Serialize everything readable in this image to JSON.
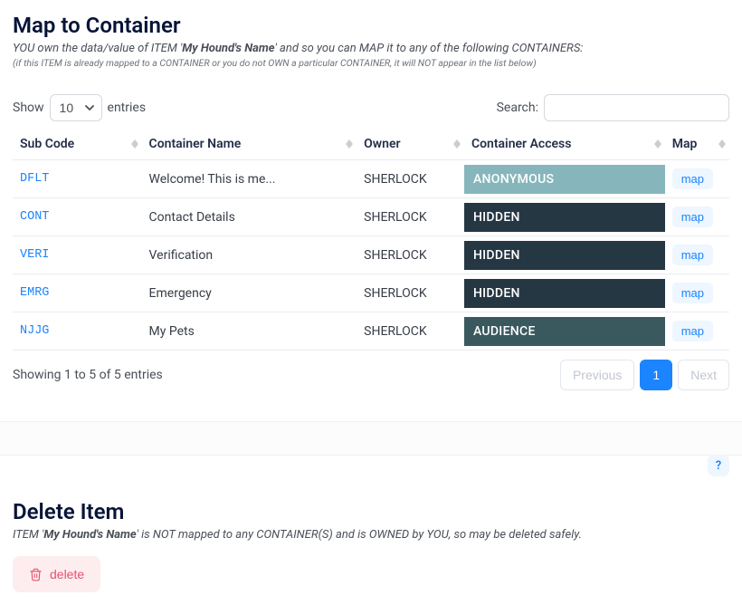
{
  "section1": {
    "title": "Map to Container",
    "subtitle_pre": "YOU own the data/value of ITEM '",
    "subtitle_item": "My Hound's Name",
    "subtitle_post": "' and so you can MAP it to any of the following CONTAINERS:",
    "note": "(if this ITEM is already mapped to a CONTAINER or you do not OWN a particular CONTAINER, it will NOT appear in the list below)"
  },
  "dt": {
    "show_label": "Show",
    "entries_label": "entries",
    "length_value": "10",
    "search_label": "Search:",
    "search_value": "",
    "columns": [
      "Sub Code",
      "Container Name",
      "Owner",
      "Container Access",
      "Map"
    ],
    "rows": [
      {
        "code": "DFLT",
        "name": "Welcome! This is me...",
        "owner": "SHERLOCK",
        "access": "ANONYMOUS",
        "access_class": "ab-anonymous",
        "map": "map"
      },
      {
        "code": "CONT",
        "name": "Contact Details",
        "owner": "SHERLOCK",
        "access": "HIDDEN",
        "access_class": "ab-hidden",
        "map": "map"
      },
      {
        "code": "VERI",
        "name": "Verification",
        "owner": "SHERLOCK",
        "access": "HIDDEN",
        "access_class": "ab-hidden",
        "map": "map"
      },
      {
        "code": "EMRG",
        "name": "Emergency",
        "owner": "SHERLOCK",
        "access": "HIDDEN",
        "access_class": "ab-hidden",
        "map": "map"
      },
      {
        "code": "NJJG",
        "name": "My Pets",
        "owner": "SHERLOCK",
        "access": "AUDIENCE",
        "access_class": "ab-audience",
        "map": "map"
      }
    ],
    "info": "Showing 1 to 5 of 5 entries",
    "prev": "Previous",
    "page": "1",
    "next": "Next"
  },
  "help": "?",
  "section2": {
    "title": "Delete Item",
    "subtitle_pre": "ITEM '",
    "subtitle_item": "My Hound's Name",
    "subtitle_post": "' is NOT mapped to any CONTAINER(S) and is OWNED by YOU, so may be deleted safely.",
    "delete_label": "delete"
  }
}
